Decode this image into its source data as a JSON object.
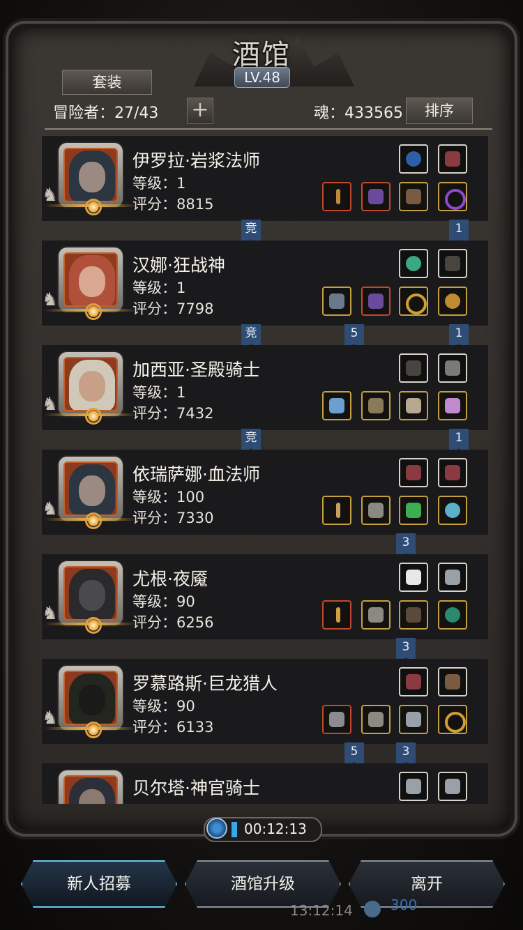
{
  "header": {
    "title": "酒馆",
    "level": "LV.48"
  },
  "toolbar": {
    "set_button": "套装",
    "adventurers": "冒险者：27/43",
    "add": "+",
    "soul": "魂：433565",
    "sort_button": "排序"
  },
  "heroes": [
    {
      "name": "伊罗拉·岩浆法师",
      "level": "等级：1",
      "score": "评分：8815"
    },
    {
      "name": "汉娜·狂战神",
      "level": "等级：1",
      "score": "评分：7798"
    },
    {
      "name": "加西亚·圣殿骑士",
      "level": "等级：1",
      "score": "评分：7432"
    },
    {
      "name": "依瑞萨娜·血法师",
      "level": "等级：100",
      "score": "评分：7330"
    },
    {
      "name": "尤根·夜魇",
      "level": "等级：90",
      "score": "评分：6256"
    },
    {
      "name": "罗慕路斯·巨龙猎人",
      "level": "等级：90",
      "score": "评分：6133"
    },
    {
      "name": "贝尔塔·神官骑士",
      "level": "",
      "score": ""
    }
  ],
  "tags": {
    "jing": "竞",
    "one": "1",
    "three": "3",
    "five": "5"
  },
  "timer": {
    "value": "00:12:13"
  },
  "buttons": {
    "recruit": "新人招募",
    "upgrade": "酒馆升级",
    "leave": "离开"
  },
  "status": {
    "clock": "13:12:14",
    "coins": "300"
  },
  "colors": {
    "accent": "#3fb4ff",
    "tag_blue": "#2e4c74",
    "gold_border": "#c4a040",
    "red_border": "#c0482a"
  }
}
